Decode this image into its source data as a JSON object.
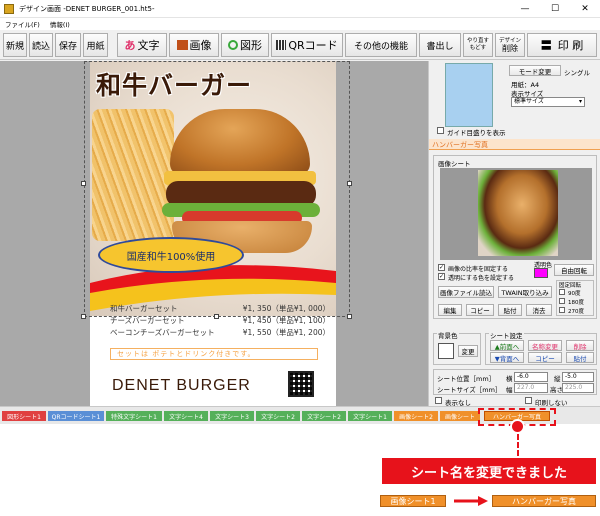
{
  "window": {
    "title": "デザイン画面 -DENET BURGER_001.ht5-",
    "controls": [
      "—",
      "☐",
      "✕"
    ]
  },
  "menu": [
    "ファイル(F)",
    "情報(I)"
  ],
  "toolbar": {
    "new": "新規",
    "open": "読込",
    "save": "保存",
    "paper": "用紙",
    "text": "文字",
    "image": "画像",
    "shape": "図形",
    "qr": "QRコード",
    "other": "その他の機能",
    "export": "書出し",
    "undo": "やり直す",
    "redo": "もどす",
    "design_delete_top": "デザイン",
    "design_delete": "削除",
    "print": "印 刷"
  },
  "poster": {
    "title": "和牛バーガー",
    "badge": "国産和牛100%使用",
    "menu_items": [
      {
        "name": "和牛バーガーセット",
        "price": "¥1, 350（単品¥1, 000）"
      },
      {
        "name": "チーズバーガーセット",
        "price": "¥1, 450（単品¥1, 100）"
      },
      {
        "name": "ベーコンチーズバーガーセット",
        "price": "¥1, 550（単品¥1, 200）"
      }
    ],
    "note": "セットは ポテトとドリンク付きです。",
    "brand": "DENET BURGER"
  },
  "right_panel": {
    "mode_button": "モード変更",
    "mode_value": "シングル",
    "paper_label": "用紙：A4",
    "display_size_label": "表示サイズ",
    "display_size_value": "標準サイズ",
    "guide_checkbox": "ガイド目盛りを表示",
    "sheet_name": "ハンバーガー写真",
    "image_sheet_group": "画像シート",
    "keep_ratio": "画像の比率を固定する",
    "transparent_set": "透明にする色を設定する",
    "transparent_color_label": "透明色",
    "free_rotate": "自由回転",
    "load_image_file": "画像ファイル読込",
    "twain": "TWAIN取り込み",
    "edit": "編集",
    "copy": "コピー",
    "paste": "貼付",
    "erase": "消去",
    "fixed_rotate_label": "固定回転",
    "rotate_options": [
      "90度",
      "180度",
      "270度"
    ],
    "bg_color_label": "背景色",
    "change": "変更",
    "sheet_settings_label": "シート設定",
    "to_front": "▲前面へ",
    "to_back": "▼背面へ",
    "rename": "名称変更",
    "copy2": "コピー",
    "delete_top": "削除",
    "paste2": "貼付",
    "sheet_position_label": "シート位置［mm］",
    "sheet_size_label": "シートサイズ［mm］",
    "x_label": "横",
    "x_value": "-6.0",
    "y_label": "縦",
    "y_value": "-5.0",
    "w_label": "幅",
    "w_value": "227.0",
    "h_label": "高さ",
    "h_value": "225.0",
    "show_label": "表示なし",
    "lock_label": "印刷しない"
  },
  "sheet_tabs": [
    {
      "label": "図形シート1",
      "color": "#e04040"
    },
    {
      "label": "QRコードシート1",
      "color": "#5a8fd6"
    },
    {
      "label": "特殊文字シート1",
      "color": "#55b05a"
    },
    {
      "label": "文字シート4",
      "color": "#55b05a"
    },
    {
      "label": "文字シート3",
      "color": "#55b05a"
    },
    {
      "label": "文字シート2",
      "color": "#55b05a"
    },
    {
      "label": "文字シート2",
      "color": "#55b05a"
    },
    {
      "label": "文字シート1",
      "color": "#55b05a"
    },
    {
      "label": "画像シート2",
      "color": "#f0902a"
    },
    {
      "label": "画像シート",
      "color": "#f0902a"
    },
    {
      "label": "ハンバーガー写真",
      "color": "#f0902a"
    }
  ],
  "annotation": {
    "message": "シート名を変更できました",
    "before": "画像シート1",
    "after": "ハンバーガー写真"
  }
}
